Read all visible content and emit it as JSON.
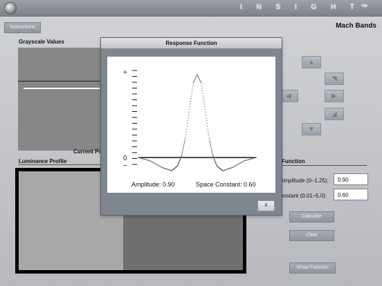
{
  "header": {
    "brand": "I N S I G H T™"
  },
  "page": {
    "title": "Mach Bands"
  },
  "toolbar": {
    "instructions_label": "Instructions"
  },
  "sections": {
    "grayscale_values": "Grayscale Values",
    "current_position": "Current Pos",
    "luminance_profile": "Luminance Profile",
    "function": "Function"
  },
  "controls": {
    "amplitude_label": "Amplitude (0–1.25):",
    "amplitude_value": "0.90",
    "space_constant_label": "onstant (0.01–5.0):",
    "space_constant_value": "0.60",
    "calculate_label": "Calculate",
    "clear_label": "Clear",
    "show_function_label": "Show Function"
  },
  "direction_buttons": {
    "up": "▲",
    "up_right": "◥",
    "left": "◀",
    "right": "▶",
    "down_right": "◢",
    "down": "▼"
  },
  "modal": {
    "title": "Response Function",
    "amplitude_text": "Amplitude: 0.90",
    "space_constant_text": "Space Constant: 0.60",
    "close_label": "X"
  },
  "chart_data": {
    "type": "line",
    "title": "",
    "xlabel": "",
    "ylabel": "",
    "y_tick_labels": [
      "+",
      "0",
      "–"
    ],
    "series": [
      {
        "x": [
          -3,
          -2.4,
          -1.8,
          -1.3,
          -1,
          -0.8,
          -0.6,
          -0.4,
          -0.2,
          0,
          0.2,
          0.4,
          0.6,
          0.8,
          1,
          1.3,
          1.8,
          2.4,
          3
        ],
        "values": [
          0,
          -0.04,
          -0.12,
          -0.16,
          -0.1,
          0.02,
          0.24,
          0.58,
          0.9,
          1.0,
          0.9,
          0.58,
          0.24,
          0.02,
          -0.1,
          -0.16,
          -0.12,
          -0.04,
          0
        ]
      }
    ],
    "grid": false,
    "legend": "none"
  },
  "colors": {
    "topbar": "#868b92",
    "background": "#bfc1c6",
    "modal_frame": "#7f8690",
    "plot_background": "#ffffff",
    "plot_baseline": "#111111",
    "plot_dots": "#707070",
    "gray_panel": "#868686",
    "dark_gray": "#707070",
    "light_gray": "#a8a8a8"
  }
}
